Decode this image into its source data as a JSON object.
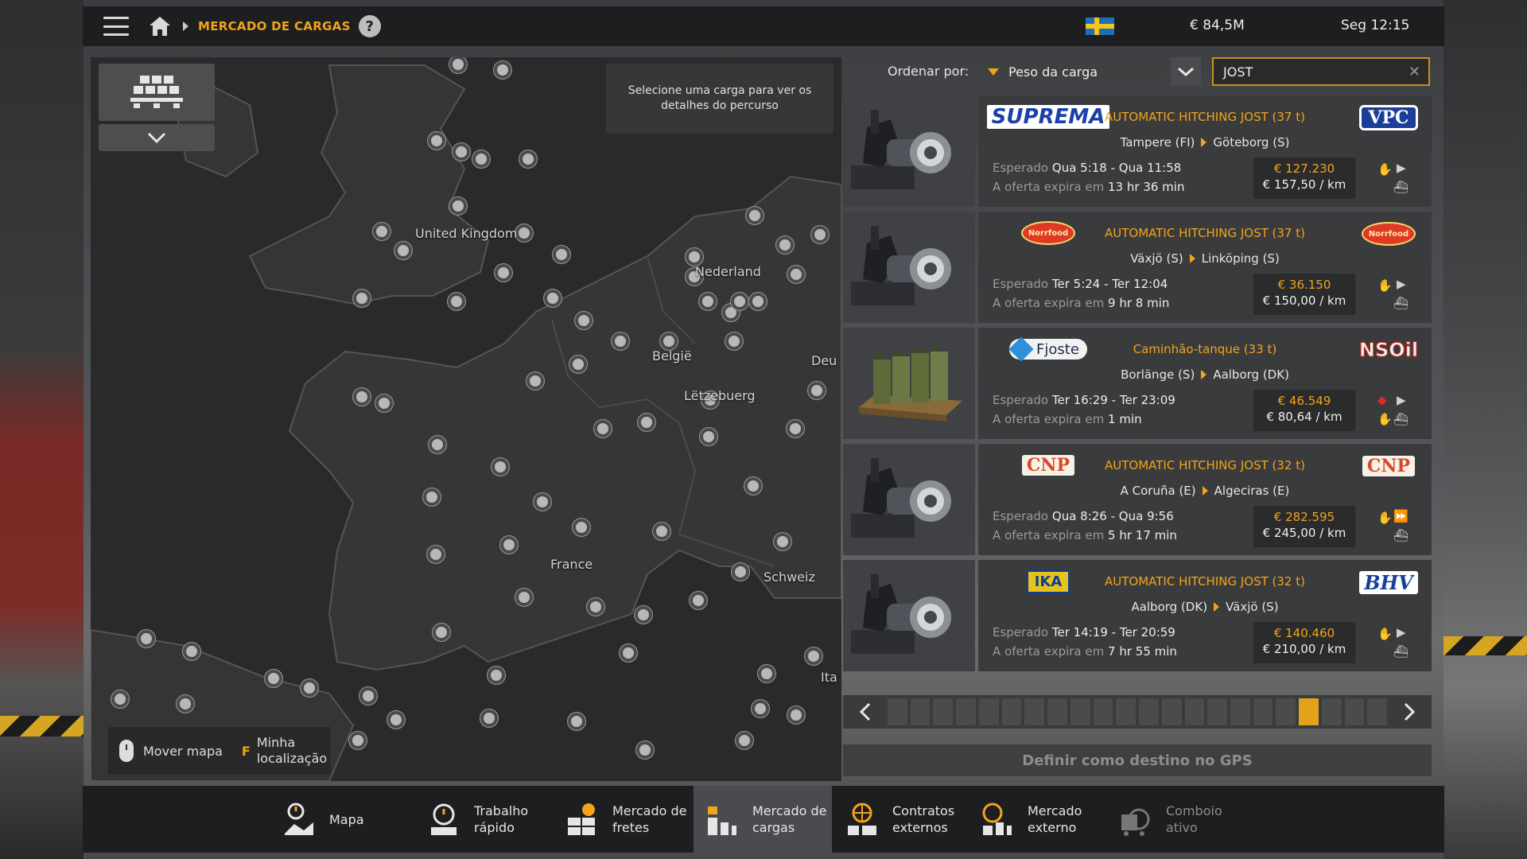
{
  "topbar": {
    "breadcrumb": "MERCADO DE CARGAS",
    "help": "?",
    "money": "€ 84,5M",
    "clock": "Seg 12:15"
  },
  "map": {
    "info_text": "Selecione uma carga para ver os detalhes do percurso",
    "labels": {
      "uk": "United Kingdom",
      "nl": "Nederland",
      "be": "België",
      "lu": "Lëtzebuerg",
      "de": "Deu",
      "fr": "France",
      "ch": "Schweiz",
      "it": "Ita"
    },
    "help_move": "Mover mapa",
    "help_key": "F",
    "help_location_1": "Minha",
    "help_location_2": "localização"
  },
  "sort": {
    "label": "Ordenar por:",
    "value": "Peso da carga"
  },
  "search": {
    "value": "JOST"
  },
  "cargos": [
    {
      "title": "AUTOMATIC HITCHING JOST (37 t)",
      "from": "Tampere (FI)",
      "to": "Göteborg (S)",
      "expected_label": "Esperado",
      "expected": "Qua 5:18 - Qua 11:58",
      "expires_label": "A oferta expira em",
      "expires": "13 hr 36 min",
      "price": "€ 127.230",
      "per_km": "€ 157,50 / km",
      "logo_left": "SUPREMA",
      "logo_right": "VPC"
    },
    {
      "title": "AUTOMATIC HITCHING JOST (37 t)",
      "from": "Växjö (S)",
      "to": "Linköping (S)",
      "expected_label": "Esperado",
      "expected": "Ter 5:24 - Ter 12:04",
      "expires_label": "A oferta expira em",
      "expires": "9 hr 8 min",
      "price": "€ 36.150",
      "per_km": "€ 150,00 / km",
      "logo_left": "Norrfood",
      "logo_right": "Norrfood"
    },
    {
      "title": "Caminhão-tanque (33 t)",
      "from": "Borlänge (S)",
      "to": "Aalborg (DK)",
      "expected_label": "Esperado",
      "expected": "Ter 16:29 - Ter 23:09",
      "expires_label": "A oferta expira em",
      "expires": "1 min",
      "price": "€ 46.549",
      "per_km": "€ 80,64 / km",
      "logo_left": "Fjoste",
      "logo_right": "NSOil"
    },
    {
      "title": "AUTOMATIC HITCHING JOST (32 t)",
      "from": "A Coruña (E)",
      "to": "Algeciras (E)",
      "expected_label": "Esperado",
      "expected": "Qua 8:26 - Qua 9:56",
      "expires_label": "A oferta expira em",
      "expires": "5 hr 17 min",
      "price": "€ 282.595",
      "per_km": "€ 245,00 / km",
      "logo_left": "CNP",
      "logo_right": "CNP"
    },
    {
      "title": "AUTOMATIC HITCHING JOST (32 t)",
      "from": "Aalborg (DK)",
      "to": "Växjö (S)",
      "expected_label": "Esperado",
      "expected": "Ter 14:19 - Ter 20:59",
      "expires_label": "A oferta expira em",
      "expires": "7 hr 55 min",
      "price": "€ 140.460",
      "per_km": "€ 210,00 / km",
      "logo_left": "IKA",
      "logo_right": "BHV"
    }
  ],
  "pager": {
    "pages": 22,
    "current": 19
  },
  "gps_button": "Definir como destino no GPS",
  "bottom_nav": {
    "map": "Mapa",
    "quick_1": "Trabalho",
    "quick_2": "rápido",
    "freight_1": "Mercado de",
    "freight_2": "fretes",
    "cargo_1": "Mercado de",
    "cargo_2": "cargas",
    "contracts_1": "Contratos",
    "contracts_2": "externos",
    "external_1": "Mercado",
    "external_2": "externo",
    "convoy_1": "Comboio",
    "convoy_2": "ativo"
  },
  "colors": {
    "accent": "#f2a41a",
    "panel": "#3a3b3d",
    "topbar": "#1c1d1f"
  }
}
